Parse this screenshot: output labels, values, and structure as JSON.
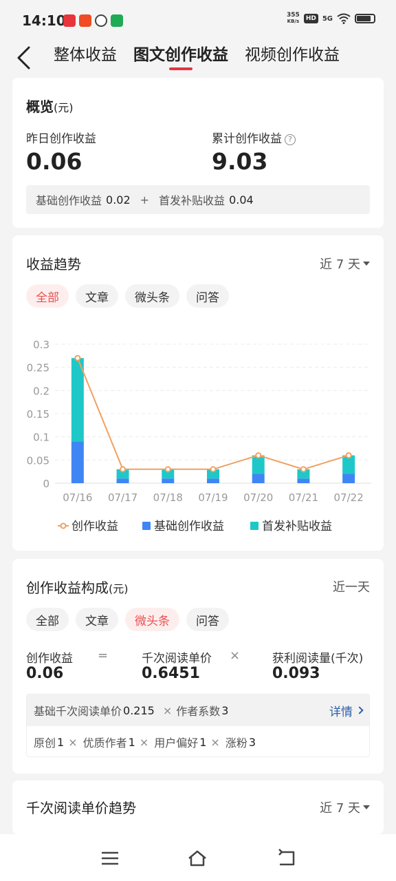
{
  "status": {
    "time": "14:10",
    "net_speed_value": "355",
    "net_speed_unit": "KB/s",
    "hd": "HD",
    "signal": "5G"
  },
  "nav": {
    "tabs": [
      "整体收益",
      "图文创作收益",
      "视频创作收益"
    ],
    "active_tab": 1
  },
  "overview": {
    "title": "概览",
    "unit": "(元)",
    "yesterday_label": "昨日创作收益",
    "yesterday_value": "0.06",
    "total_label": "累计创作收益",
    "total_value": "9.03",
    "help": "?",
    "base_label": "基础创作收益",
    "base_value": "0.02",
    "plus": "+",
    "bonus_label": "首发补贴收益",
    "bonus_value": "0.04"
  },
  "trend": {
    "title": "收益趋势",
    "range": "近 7 天",
    "chips": [
      "全部",
      "文章",
      "微头条",
      "问答"
    ],
    "active_chip": 0
  },
  "chart_data": {
    "type": "bar",
    "categories": [
      "07/16",
      "07/17",
      "07/18",
      "07/19",
      "07/20",
      "07/21",
      "07/22"
    ],
    "series": [
      {
        "name": "创作收益",
        "kind": "line",
        "color": "#f0a060",
        "values": [
          0.27,
          0.03,
          0.03,
          0.03,
          0.06,
          0.03,
          0.06
        ]
      },
      {
        "name": "基础创作收益",
        "kind": "bar",
        "color": "#3f86f5",
        "values": [
          0.09,
          0.01,
          0.01,
          0.01,
          0.02,
          0.01,
          0.02
        ]
      },
      {
        "name": "首发补贴收益",
        "kind": "bar",
        "color": "#1fc8c8",
        "values": [
          0.18,
          0.02,
          0.02,
          0.02,
          0.04,
          0.02,
          0.04
        ]
      }
    ],
    "yticks": [
      "0.3",
      "0.25",
      "0.2",
      "0.15",
      "0.1",
      "0.05",
      "0"
    ],
    "ylim": [
      0,
      0.3
    ],
    "stacked": true,
    "grid": true,
    "legend": "bottom"
  },
  "composition": {
    "title": "创作收益构成",
    "unit": "(元)",
    "range": "近一天",
    "chips": [
      "全部",
      "文章",
      "微头条",
      "问答"
    ],
    "active_chip": 2,
    "income_label": "创作收益",
    "income_value": "0.06",
    "eq": "=",
    "unit_price_label": "千次阅读单价",
    "unit_price_value": "0.6451",
    "times": "×",
    "reads_label": "获利阅读量(千次)",
    "reads_value": "0.093",
    "base_price_label": "基础千次阅读单价",
    "base_price_value": "0.215",
    "coef_label": "作者系数",
    "coef_value": "3",
    "detail_link": "详情",
    "factors": [
      {
        "label": "原创",
        "value": "1"
      },
      {
        "label": "优质作者",
        "value": "1"
      },
      {
        "label": "用户偏好",
        "value": "1"
      },
      {
        "label": "涨粉",
        "value": "3"
      }
    ]
  },
  "price_trend": {
    "title": "千次阅读单价趋势",
    "range": "近 7 天"
  },
  "colors": {
    "accent": "#e8343b",
    "link": "#2d5fa8",
    "line": "#f0a060",
    "base_bar": "#3f86f5",
    "bonus_bar": "#1fc8c8"
  }
}
